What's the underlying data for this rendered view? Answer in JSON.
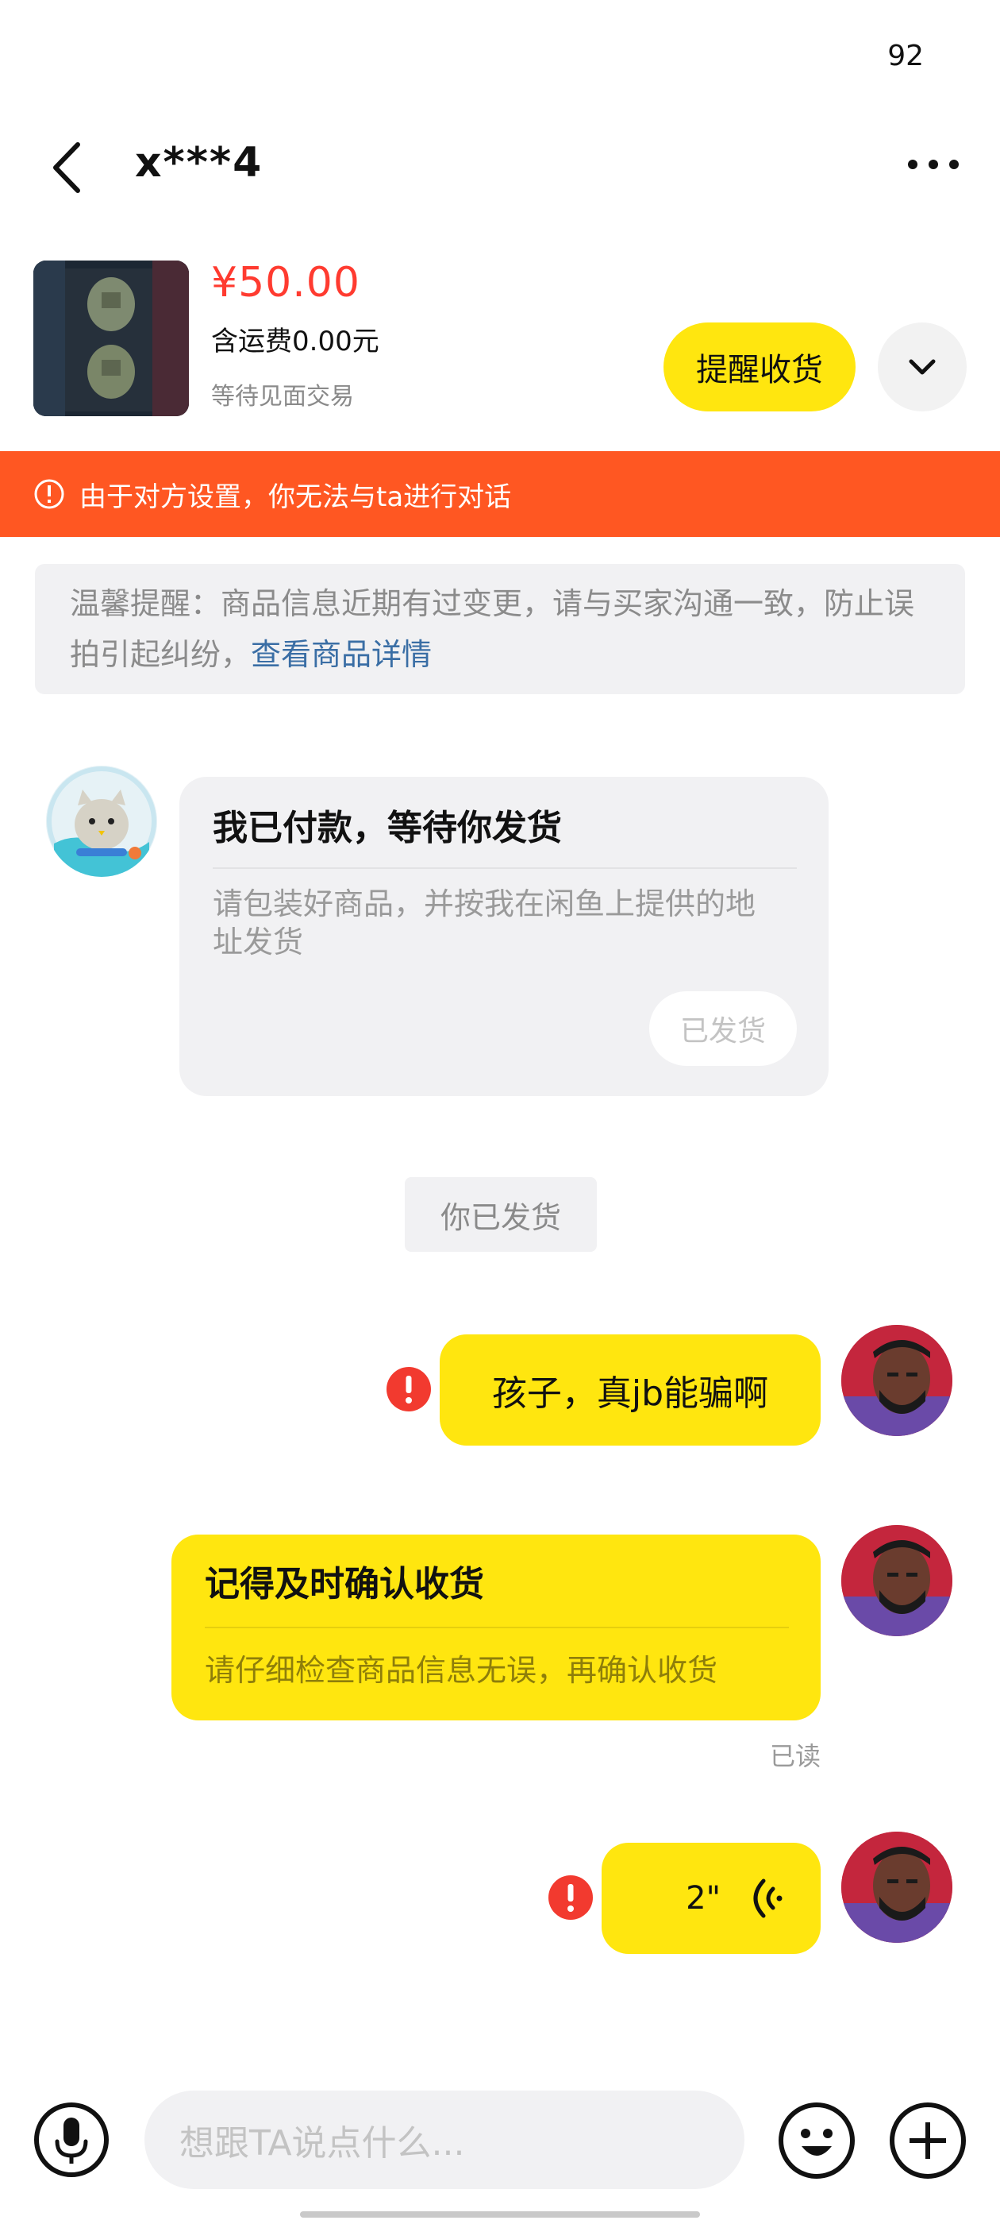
{
  "status_bar": {
    "battery": "92"
  },
  "header": {
    "title": "x***4"
  },
  "product": {
    "price": "¥50.00",
    "shipping": "含运费0.00元",
    "status": "等待见面交易",
    "remind_label": "提醒收货"
  },
  "warning_banner": {
    "text": "由于对方设置，你无法与ta进行对话"
  },
  "tip": {
    "text": "温馨提醒：商品信息近期有过变更，请与买家沟通一致，防止误拍引起纠纷，",
    "link": "查看商品详情"
  },
  "messages": {
    "payment_card": {
      "title": "我已付款，等待你发货",
      "desc": "请包装好商品，并按我在闲鱼上提供的地址发货",
      "button": "已发货"
    },
    "system_notice": "你已发货",
    "text_message": "孩子，真jb能骗啊",
    "confirm_card": {
      "title": "记得及时确认收货",
      "desc": "请仔细检查商品信息无误，再确认收货",
      "read_status": "已读"
    },
    "voice_message": {
      "duration": "2\""
    }
  },
  "input": {
    "placeholder": "想跟TA说点什么..."
  },
  "icons": [
    "back-arrow-icon",
    "more-dots-icon",
    "chevron-down-icon",
    "alert-circle-icon",
    "error-icon",
    "voice-wave-icon",
    "microphone-icon",
    "emoji-icon",
    "plus-icon"
  ],
  "colors": {
    "accent_yellow": "#ffe60f",
    "warning_orange": "#ff5722",
    "price_red": "#ff3b30",
    "link_blue": "#3a6ea5",
    "error_red": "#f23a2f"
  }
}
